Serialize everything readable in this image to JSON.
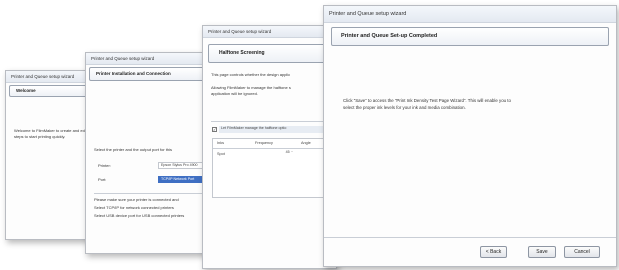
{
  "win1": {
    "title": "Printer and Queue setup wizard",
    "header": "Welcome",
    "body1": "Welcome to FilmMaker to create and edit",
    "body2": "steps to start printing quickly."
  },
  "win2": {
    "title": "Printer and Queue setup wizard",
    "header": "Printer Installation and Connection",
    "intro": "Select the printer and the output port for this",
    "printer_label": "Printer:",
    "printer_value": "Epson Stylus Pro 4900",
    "port_label": "Port:",
    "port_value": "TCP/IP Network Port",
    "note1": "Please make sure your printer is connected and",
    "note2": "Select TCP/IP for network connected printers",
    "note3": "Select USB device port for USB connected printers"
  },
  "win3": {
    "title": "Printer and Queue setup wizard",
    "header": "Halftone Screening",
    "line1": "This page controls whether the design applic",
    "line2": "Allowing FilmMaker to manage the halftone s",
    "line3": "application will be ignored.",
    "checkbox_label": "Let FilmMaker manage the halftone optio",
    "col_inks": "Inks",
    "col_frequency": "Frequency",
    "col_angle": "Angle",
    "row_ink": "Spot",
    "row_frequency": "45 ··",
    "row_angle": "22 ·"
  },
  "win4": {
    "title": "Printer and Queue setup wizard",
    "header": "Printer and Queue Set-up Completed",
    "body1": "Click “Save” to access the “Print Ink Density Test Page Wizard”. This will enable you to",
    "body2": "select the proper ink levels for your ink and media combination.",
    "back_button": "< Back",
    "save_button": "Save",
    "cancel_button": "Cancel"
  }
}
